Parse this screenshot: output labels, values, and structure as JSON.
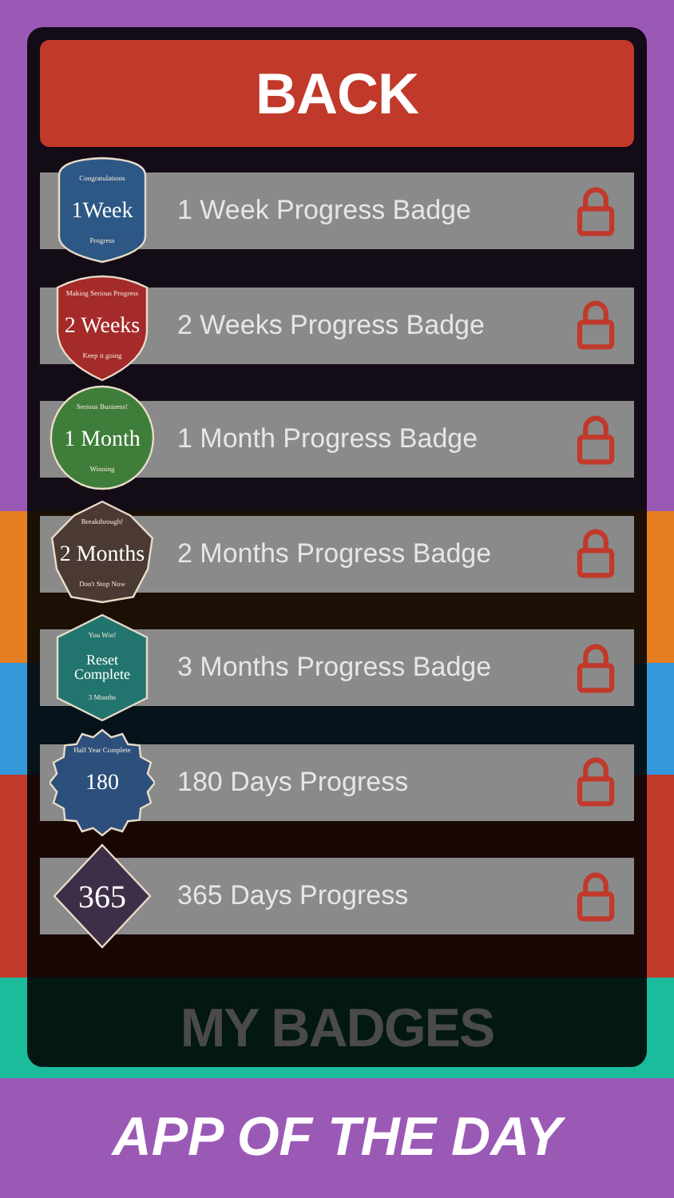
{
  "back_button": {
    "label": "BACK"
  },
  "badges": [
    {
      "title": "1 Week Progress Badge",
      "locked": true,
      "kind": "shield",
      "color": "#2d5785",
      "badge_top": "Congratulations",
      "badge_label": "1Week",
      "badge_bottom": "Progress"
    },
    {
      "title": "2 Weeks Progress Badge",
      "locked": true,
      "kind": "crest",
      "color": "#a52a2a",
      "badge_top": "Making Serious Progress",
      "badge_label": "2 Weeks",
      "badge_bottom": "Keep it going"
    },
    {
      "title": "1 Month Progress Badge",
      "locked": true,
      "kind": "circle",
      "color": "#3f7d3a",
      "badge_top": "Serious Business!",
      "badge_label": "1 Month",
      "badge_bottom": "Winning"
    },
    {
      "title": "2 Months Progress Badge",
      "locked": true,
      "kind": "scallop",
      "color": "#4a3a33",
      "badge_top": "Breakthrough!",
      "badge_label": "2 Months",
      "badge_bottom": "Don't Stop Now"
    },
    {
      "title": "3 Months Progress Badge",
      "locked": true,
      "kind": "hexagon",
      "color": "#22756e",
      "badge_top": "You Win!",
      "badge_label": "Reset Complete",
      "badge_bottom": "3 Months"
    },
    {
      "title": "180 Days Progress",
      "locked": true,
      "kind": "seal",
      "color": "#2c4f7c",
      "badge_top": "Half Year Complete",
      "badge_label": "180"
    },
    {
      "title": "365 Days Progress",
      "locked": true,
      "kind": "diamond",
      "color": "#3d2f48",
      "badge_label": "365"
    }
  ],
  "background_menu": [
    {
      "label": "MY BADGES"
    }
  ],
  "banner": {
    "label": "APP OF THE DAY"
  }
}
